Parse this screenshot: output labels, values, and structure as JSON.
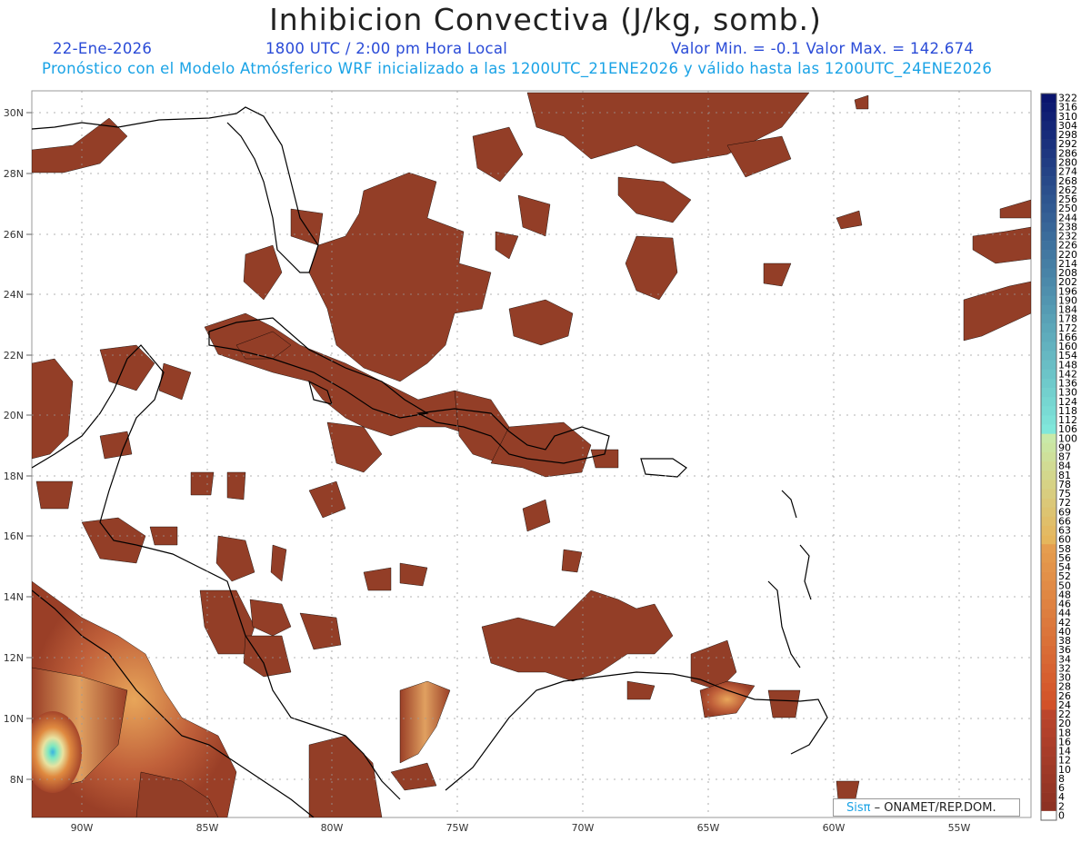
{
  "header": {
    "title": "Inhibicion Convectiva (J/kg, somb.)",
    "date": "22-Ene-2026",
    "time": "1800 UTC / 2:00 pm Hora Local",
    "minmax": "Valor Min. = -0.1  Valor Max. = 142.674",
    "forecast": "Pronóstico con el Modelo Atmósferico WRF inicializado a las 1200UTC_21ENE2026 y válido hasta las  1200UTC_24ENE2026"
  },
  "map": {
    "lon_labels": [
      "90W",
      "85W",
      "80W",
      "75W",
      "70W",
      "65W",
      "60W",
      "55W"
    ],
    "lat_labels": [
      "30N",
      "28N",
      "26N",
      "24N",
      "22N",
      "20N",
      "18N",
      "16N",
      "14N",
      "12N",
      "10N",
      "8N"
    ]
  },
  "colorbar": {
    "labels": [
      "322",
      "316",
      "310",
      "304",
      "298",
      "292",
      "286",
      "280",
      "274",
      "268",
      "262",
      "256",
      "250",
      "244",
      "238",
      "232",
      "226",
      "220",
      "214",
      "208",
      "202",
      "196",
      "190",
      "184",
      "178",
      "172",
      "166",
      "160",
      "154",
      "148",
      "142",
      "136",
      "130",
      "124",
      "118",
      "112",
      "106",
      "100",
      "90",
      "87",
      "84",
      "81",
      "78",
      "75",
      "72",
      "69",
      "66",
      "63",
      "60",
      "58",
      "56",
      "54",
      "52",
      "50",
      "48",
      "46",
      "44",
      "42",
      "40",
      "38",
      "36",
      "34",
      "32",
      "30",
      "28",
      "26",
      "24",
      "22",
      "20",
      "18",
      "16",
      "14",
      "12",
      "10",
      "8",
      "6",
      "4",
      "2",
      "0"
    ]
  },
  "credit": {
    "logo": "Sisπ",
    "text": " – ONAMET/REP.DOM."
  },
  "colors": {
    "fill_dark": "#8a3a26",
    "fill_mid": "#a5452a",
    "coast": "#000000",
    "title": "#222222",
    "header_blue": "#2a4bd7",
    "header_cyan": "#1aa3e6"
  }
}
